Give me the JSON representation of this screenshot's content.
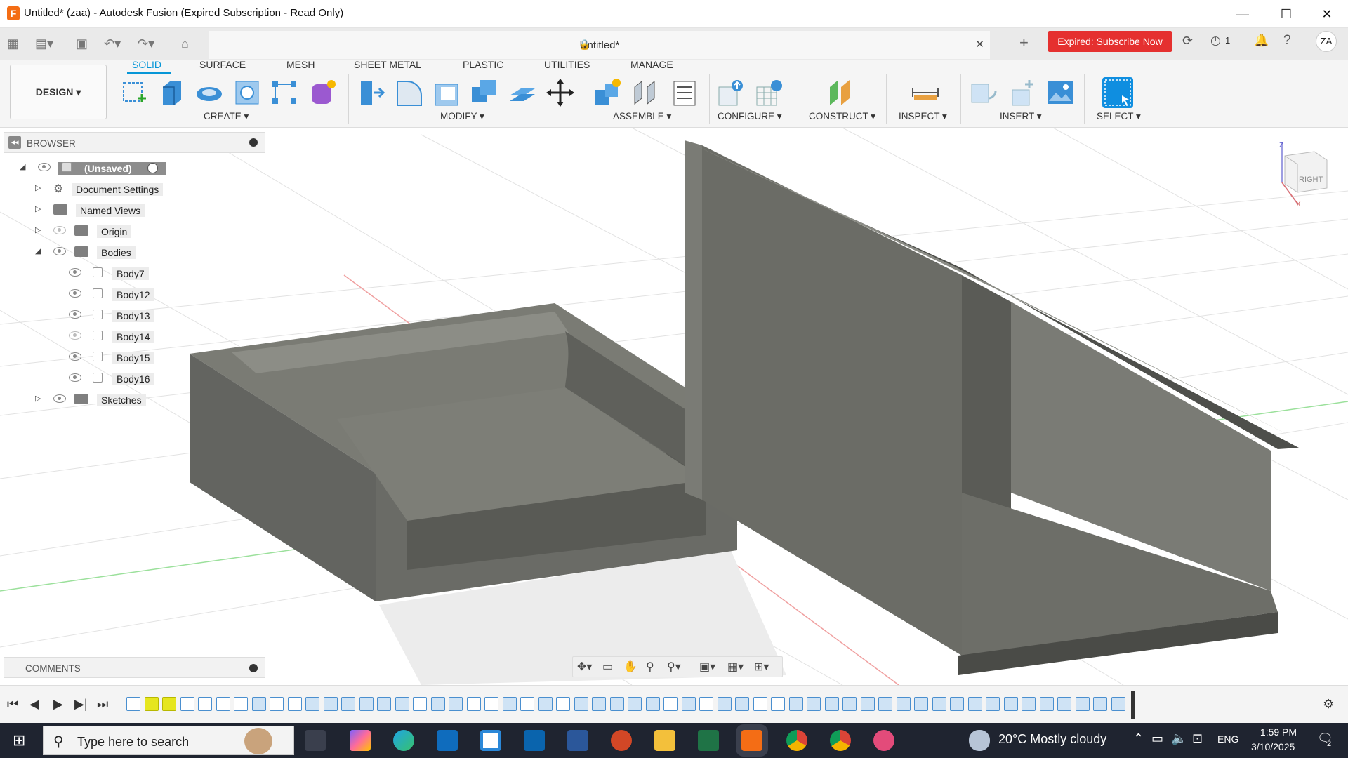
{
  "window": {
    "title": "Untitled* (zaa) - Autodesk Fusion (Expired Subscription - Read Only)",
    "app_icon_letter": "F"
  },
  "document_tab": {
    "title": "Untitled*"
  },
  "header_right": {
    "subscribe_label": "Expired: Subscribe Now",
    "jobs_count": "1",
    "user_initials": "ZA"
  },
  "workspace": {
    "label": "DESIGN ▾"
  },
  "ribbon": {
    "tabs": [
      "SOLID",
      "SURFACE",
      "MESH",
      "SHEET METAL",
      "PLASTIC",
      "UTILITIES",
      "MANAGE"
    ],
    "active_tab": "SOLID",
    "groups": [
      "CREATE ▾",
      "MODIFY ▾",
      "ASSEMBLE ▾",
      "CONFIGURE ▾",
      "CONSTRUCT ▾",
      "INSPECT ▾",
      "INSERT ▾",
      "SELECT ▾"
    ]
  },
  "browser": {
    "title": "BROWSER",
    "root": "(Unsaved)",
    "items": [
      "Document Settings",
      "Named Views",
      "Origin",
      "Bodies",
      "Sketches"
    ],
    "bodies": [
      {
        "name": "Body7",
        "visible": true
      },
      {
        "name": "Body12",
        "visible": true
      },
      {
        "name": "Body13",
        "visible": true
      },
      {
        "name": "Body14",
        "visible": false
      },
      {
        "name": "Body15",
        "visible": true
      },
      {
        "name": "Body16",
        "visible": true
      }
    ]
  },
  "comments": {
    "label": "COMMENTS"
  },
  "viewcube": {
    "face": "RIGHT",
    "axis_z": "Z",
    "axis_x": "X"
  },
  "taskbar": {
    "search_placeholder": "Type here to search",
    "weather": "20°C  Mostly cloudy",
    "language": "ENG",
    "time": "1:59 PM",
    "date": "3/10/2025",
    "notification_count": "2"
  },
  "colors": {
    "accent": "#0696d7",
    "subscribe": "#e5302f",
    "taskbar": "#1f2430",
    "body_gray": "#6f706a"
  }
}
